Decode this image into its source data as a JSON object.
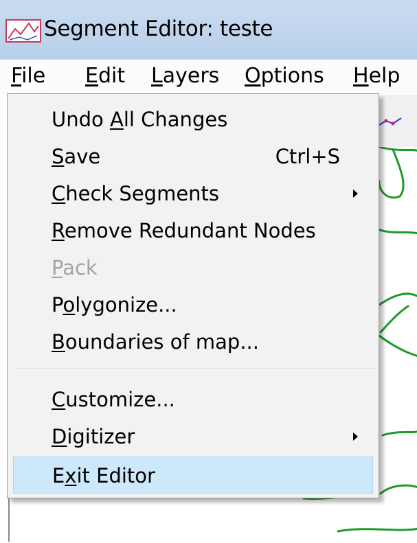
{
  "window": {
    "title": "Segment Editor: teste",
    "icon": "segment-editor-app-icon"
  },
  "menubar": {
    "items": [
      {
        "label": "File",
        "mnemonic": "F",
        "open": true
      },
      {
        "label": "Edit",
        "mnemonic": "E"
      },
      {
        "label": "Layers",
        "mnemonic": "L"
      },
      {
        "label": "Options",
        "mnemonic": "O"
      },
      {
        "label": "Help",
        "mnemonic": "H"
      }
    ]
  },
  "file_menu": {
    "items": [
      {
        "label": "Undo All Changes",
        "mnemonic": "A"
      },
      {
        "label": "Save",
        "mnemonic": "S",
        "shortcut": "Ctrl+S"
      },
      {
        "label": "Check Segments",
        "mnemonic": "C",
        "submenu": true
      },
      {
        "label": "Remove Redundant Nodes",
        "mnemonic": "R"
      },
      {
        "label": "Pack",
        "mnemonic": "P",
        "disabled": true
      },
      {
        "label": "Polygonize...",
        "mnemonic": "o"
      },
      {
        "label": "Boundaries of map...",
        "mnemonic": "B"
      },
      {
        "separator": true
      },
      {
        "label": "Customize...",
        "mnemonic": "C"
      },
      {
        "label": "Digitizer",
        "mnemonic": "D",
        "submenu": true
      },
      {
        "label": "Exit Editor",
        "mnemonic": "x",
        "highlighted": true
      }
    ]
  },
  "colors": {
    "menu_highlight": "#cde8fb",
    "segment_lines": "#1e9a2a",
    "disabled_text": "#a3a3a3",
    "titlebar": "#c3d7ee"
  }
}
